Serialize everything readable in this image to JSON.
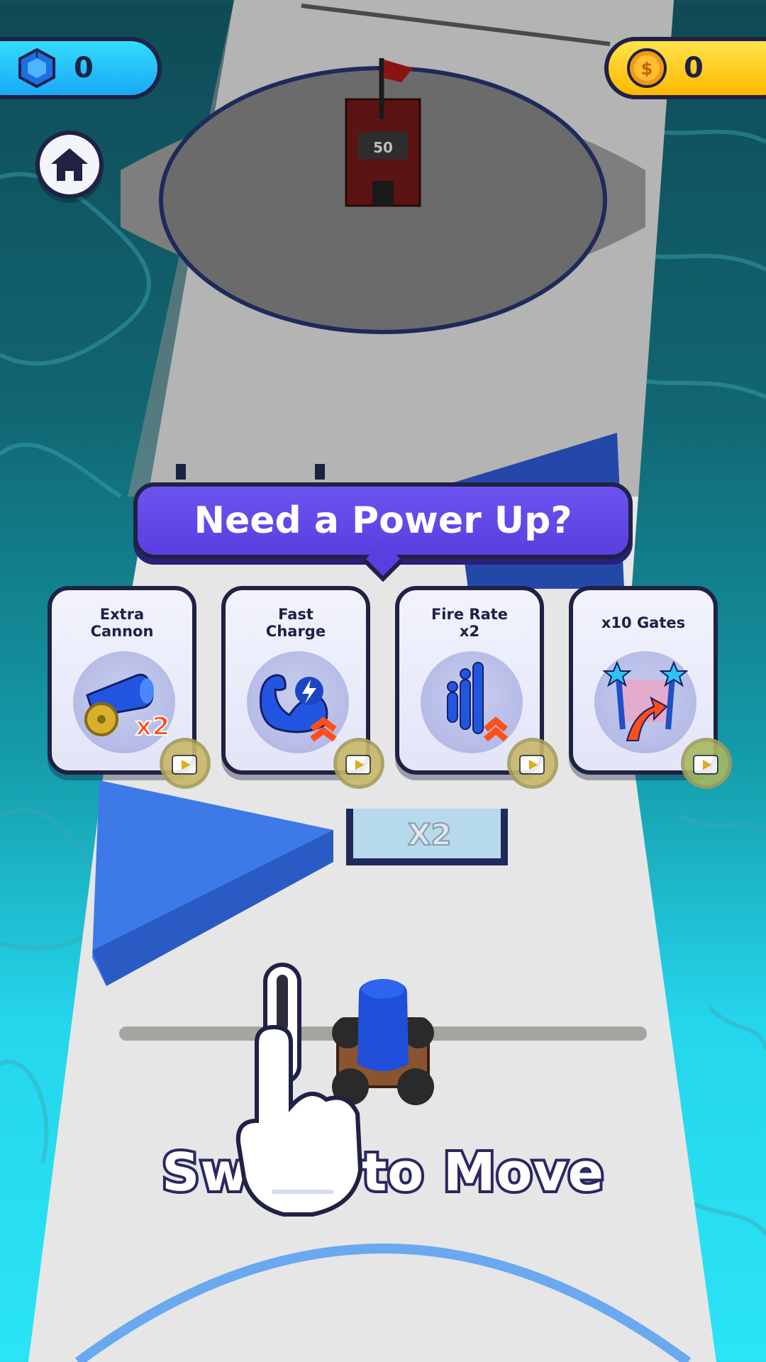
{
  "hud": {
    "gems": {
      "icon": "cube-gem-icon",
      "value": "0",
      "color": "#1aa8f5"
    },
    "coins": {
      "icon": "dollar-coin-icon",
      "value": "0",
      "color": "#ffb800"
    }
  },
  "home": {
    "icon": "home-icon"
  },
  "tower": {
    "value": "50"
  },
  "powerup": {
    "title": "Need a Power Up?",
    "cards": [
      {
        "label": "Extra\nCannon",
        "icon": "cannon-x2-icon",
        "badge_icon": "video-ad-icon"
      },
      {
        "label": "Fast\nCharge",
        "icon": "flexed-arm-lightning-icon",
        "badge_icon": "video-ad-icon"
      },
      {
        "label": "Fire Rate\nx2",
        "icon": "shooting-figures-icon",
        "badge_icon": "video-ad-icon"
      },
      {
        "label": "x10 Gates",
        "icon": "star-gate-arrow-icon",
        "badge_icon": "video-ad-icon"
      }
    ]
  },
  "gate": {
    "label": "X2"
  },
  "hint": {
    "text": "Swipe to Move",
    "visible_text": "Sl    to Move"
  },
  "colors": {
    "accent_purple": "#5a3fe0",
    "outline": "#1f2145",
    "cannon_blue": "#1f4fd8"
  }
}
